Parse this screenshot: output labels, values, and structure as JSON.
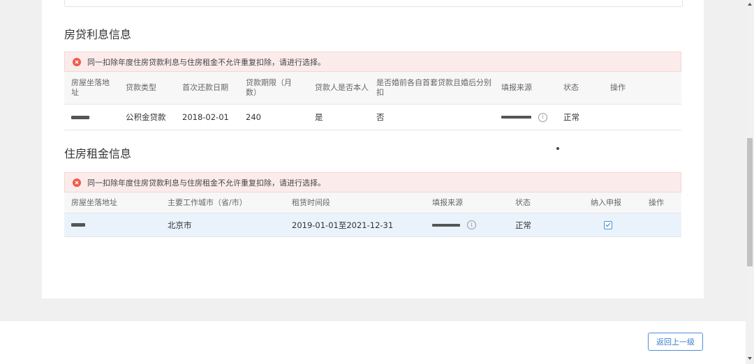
{
  "loan_section": {
    "title": "房贷利息信息",
    "alert": "同一扣除年度住房贷款利息与住房租金不允许重复扣除，请进行选择。",
    "headers": [
      "房屋坐落地址",
      "贷款类型",
      "首次还款日期",
      "贷款期限（月数）",
      "贷款人是否本人",
      "是否婚前各自首套贷款且婚后分别扣",
      "填报来源",
      "状态",
      "操作"
    ],
    "rows": [
      {
        "type": "公积金贷款",
        "first_date": "2018-02-01",
        "term": "240",
        "is_self": "是",
        "separate": "否",
        "status": "正常"
      }
    ]
  },
  "rent_section": {
    "title": "住房租金信息",
    "alert": "同一扣除年度住房贷款利息与住房租金不允许重复扣除，请进行选择。",
    "headers": [
      "房屋坐落地址",
      "主要工作城市（省/市）",
      "租赁时间段",
      "填报来源",
      "状态",
      "纳入申报",
      "操作"
    ],
    "rows": [
      {
        "city": "北京市",
        "period": "2019-01-01至2021-12-31",
        "status": "正常",
        "included": true
      }
    ]
  },
  "footer": {
    "back_label": "返回上一级"
  },
  "icons": {
    "alert": "error-circle-icon",
    "info": "info-icon",
    "check": "checkbox-checked-icon"
  },
  "colors": {
    "accent": "#4a90d9",
    "alert_bg": "#fbeceb",
    "error": "#f05a4a"
  }
}
